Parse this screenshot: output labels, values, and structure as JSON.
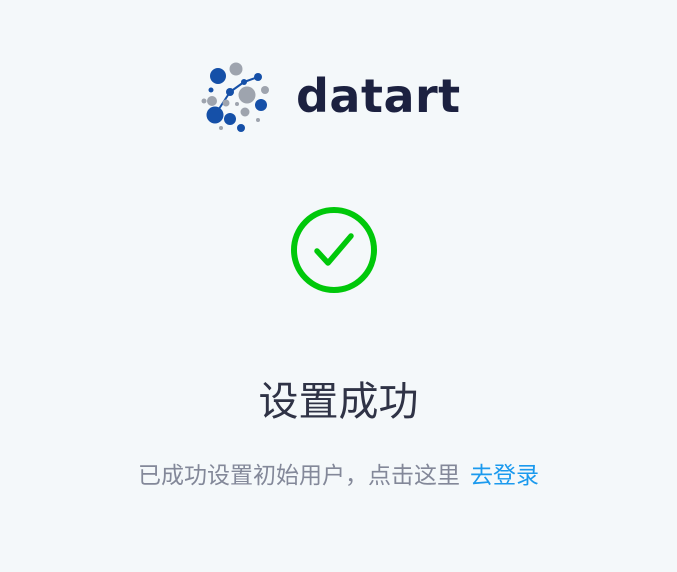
{
  "brand": {
    "logo_icon": "datart-molecule-logo",
    "name": "datart",
    "colors": {
      "blue": "#1550a8",
      "gray": "#9ea4ae",
      "text": "#1c2140"
    }
  },
  "status": {
    "icon": "check-circle-icon",
    "color": "#00c80a",
    "title": "设置成功",
    "message": "已成功设置初始用户，点击这里",
    "link_label": "去登录",
    "link_color": "#1b9aee"
  }
}
